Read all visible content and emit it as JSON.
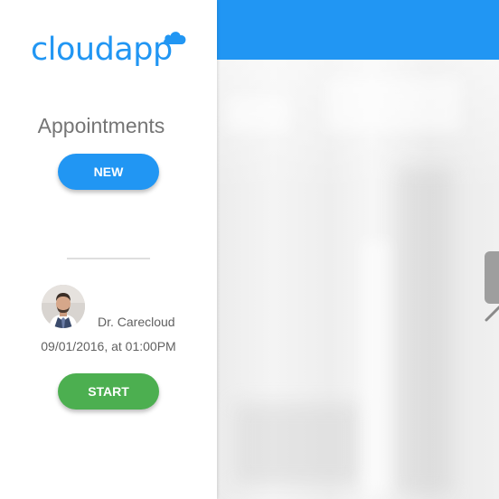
{
  "logo": {
    "text": "cloudapp",
    "color": "#2196f3"
  },
  "sidebar": {
    "title": "Appointments",
    "new_button": "NEW"
  },
  "appointment": {
    "doctor": "Dr. Carecloud",
    "datetime": "09/01/2016, at 01:00PM",
    "start_button": "START"
  },
  "colors": {
    "primary": "#2196f3",
    "success": "#4caf50",
    "text_muted": "#757575"
  }
}
